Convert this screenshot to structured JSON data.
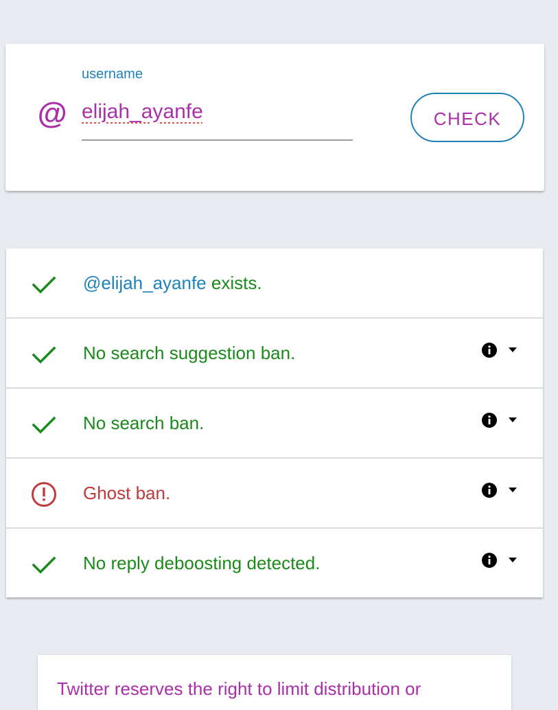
{
  "form": {
    "label": "username",
    "at_symbol": "@",
    "value": "elijah_ayanfe",
    "button_label": "CHECK",
    "accent_color": "#ab2fa9",
    "label_color": "#1e82b9"
  },
  "results": [
    {
      "icon": "checkmark-icon",
      "status": "ok",
      "handle": "@elijah_ayanfe",
      "text": " exists.",
      "has_info": false
    },
    {
      "icon": "checkmark-icon",
      "status": "ok",
      "handle": "",
      "text": "No search suggestion ban.",
      "has_info": true
    },
    {
      "icon": "checkmark-icon",
      "status": "ok",
      "handle": "",
      "text": "No search ban.",
      "has_info": true
    },
    {
      "icon": "alert-circle-icon",
      "status": "fail",
      "handle": "",
      "text": "Ghost ban.",
      "has_info": true
    },
    {
      "icon": "checkmark-icon",
      "status": "ok",
      "handle": "",
      "text": "No reply deboosting detected.",
      "has_info": true
    }
  ],
  "colors": {
    "ok": "#1a8a1a",
    "fail": "#c0393b",
    "background": "#e8ebef"
  },
  "note": {
    "text": "Twitter reserves the right to limit distribution or"
  }
}
